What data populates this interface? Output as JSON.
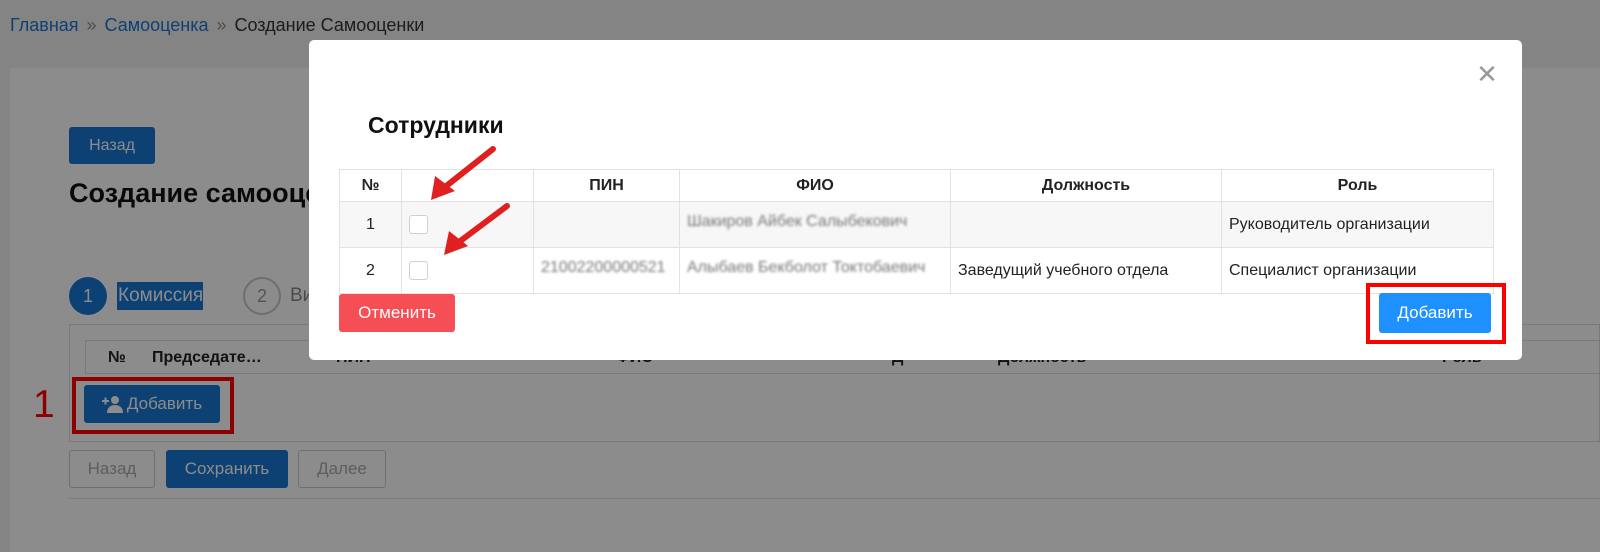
{
  "breadcrumb": {
    "items": [
      "Главная",
      "Самооценка",
      "Создание Самооценки"
    ],
    "separator": "»"
  },
  "page": {
    "back_top_label": "Назад",
    "title": "Создание самооценки",
    "steps": [
      {
        "number": "1",
        "label": "Комиссия"
      },
      {
        "number": "2",
        "label": "Ви"
      }
    ],
    "table_headers": [
      "№",
      "Председате…",
      "ПИН",
      "ФИО",
      "Д",
      "Должность",
      "Роль"
    ],
    "add_label": "Добавить",
    "back_label": "Назад",
    "save_label": "Сохранить",
    "next_label": "Далее"
  },
  "annotations": {
    "step_number": "1",
    "highlight_color": "#ff0000",
    "arrow_color": "#e02020"
  },
  "modal": {
    "title": "Сотрудники",
    "close_icon": "close-icon",
    "columns": [
      "№",
      "",
      "ПИН",
      "ФИО",
      "Должность",
      "Роль"
    ],
    "rows": [
      {
        "num": "1",
        "pin": "",
        "fio": "Шакиров Айбек Салыбекович",
        "position": "",
        "role": "Руководитель организации"
      },
      {
        "num": "2",
        "pin": "21002200000521",
        "fio": "Алыбаев Бекболот Токтобаевич",
        "position": "Заведущий учебного отдела",
        "role": "Специалист организации"
      }
    ],
    "cancel_label": "Отменить",
    "add_label": "Добавить"
  },
  "colors": {
    "primary": "#1976d2",
    "modal_add": "#1e90ff",
    "cancel": "#f54e55"
  }
}
